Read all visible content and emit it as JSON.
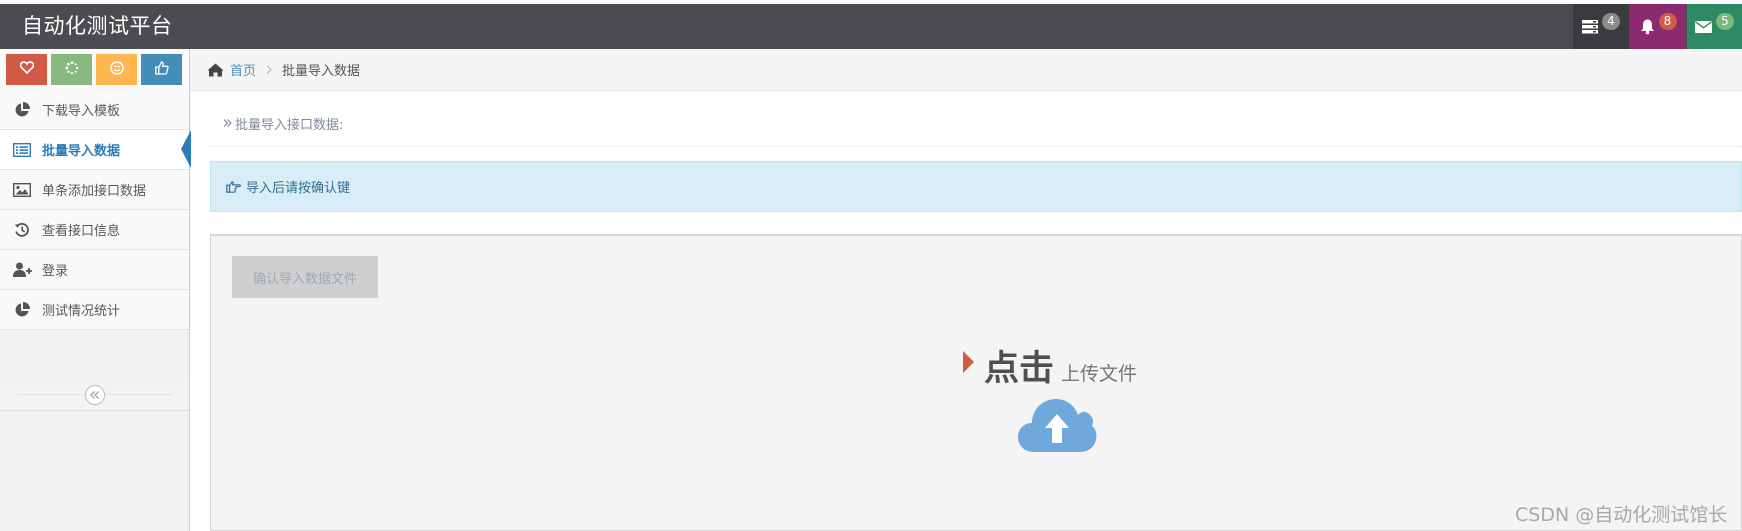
{
  "app": {
    "title": "自动化测试平台"
  },
  "navbar": {
    "tasks": {
      "icon": "tasks-icon",
      "count": "4",
      "badge_color": "#8b8b8b"
    },
    "notifications": {
      "icon": "bell-icon",
      "count": "8",
      "badge_color": "#d15b47"
    },
    "messages": {
      "icon": "envelope-icon",
      "count": "5",
      "badge_color": "#7aba7b"
    }
  },
  "shortcuts": [
    {
      "icon": "heart-icon",
      "color": "#d15b47"
    },
    {
      "icon": "spinner-icon",
      "color": "#87b87f"
    },
    {
      "icon": "smile-icon",
      "color": "#ffb752"
    },
    {
      "icon": "thumbs-up-icon",
      "color": "#438eb9"
    }
  ],
  "sidebar": {
    "items": [
      {
        "label": "下载导入模板",
        "icon": "pie-chart-icon",
        "active": false
      },
      {
        "label": "批量导入数据",
        "icon": "list-alt-icon",
        "active": true
      },
      {
        "label": "单条添加接口数据",
        "icon": "picture-icon",
        "active": false
      },
      {
        "label": "查看接口信息",
        "icon": "history-icon",
        "active": false
      },
      {
        "label": "登录",
        "icon": "user-plus-icon",
        "active": false
      },
      {
        "label": "测试情况统计",
        "icon": "pie-chart-icon",
        "active": false
      }
    ],
    "collapse_icon": "double-angle-left-icon"
  },
  "breadcrumbs": {
    "home": "首页",
    "current": "批量导入数据"
  },
  "page_header": {
    "text": "批量导入接口数据:"
  },
  "alert": {
    "icon": "hand-right-icon",
    "text": "导入后请按确认键"
  },
  "upload": {
    "confirm_button": "确认导入数据文件",
    "prompt_big": "点击",
    "prompt_small": "上传文件",
    "icon": "cloud-upload-icon"
  },
  "watermark": "CSDN @自动化测试馆长"
}
